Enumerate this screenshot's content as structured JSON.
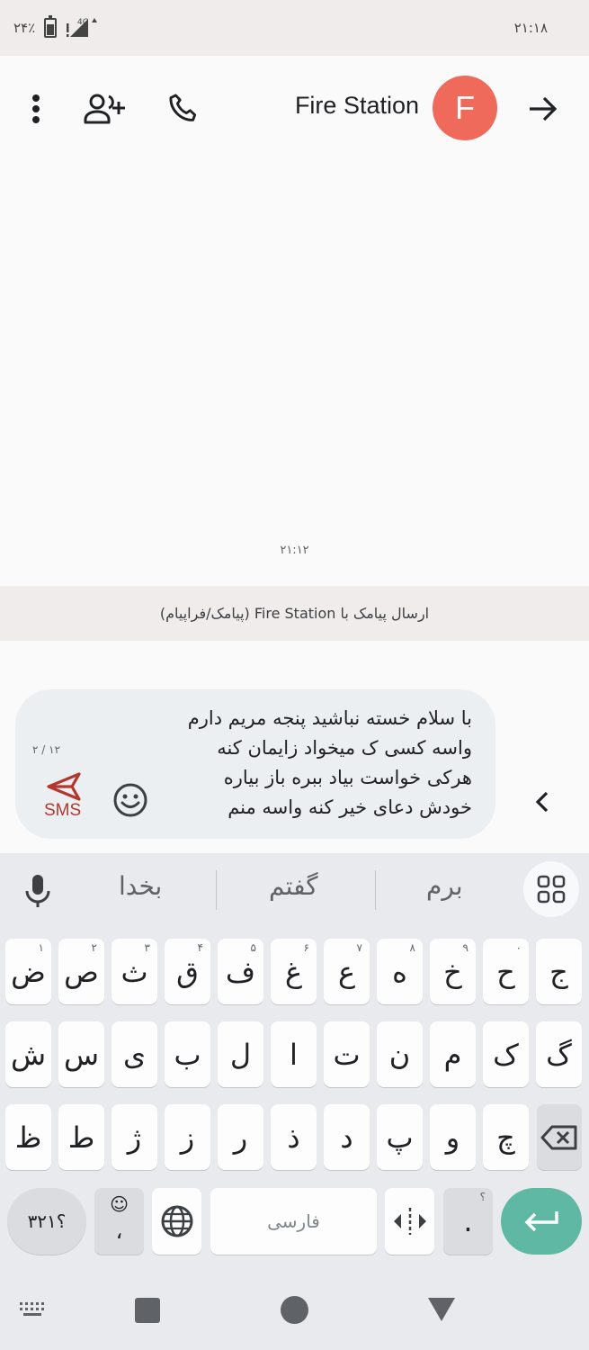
{
  "status_bar": {
    "time": "۲۱:۱۸",
    "battery_percent": "۲۴٪",
    "network": "4G"
  },
  "app_bar": {
    "contact_name": "Fire Station",
    "avatar_letter": "F",
    "icons": [
      "more-vert-icon",
      "add-person-icon",
      "phone-icon",
      "arrow-forward-icon"
    ]
  },
  "conversation": {
    "timestamp": "۲۱:۱۲",
    "send_banner": "ارسال پیامک با Fire Station (پیامک/فراپیام)"
  },
  "compose": {
    "lines": [
      "با سلام خسته نباشید پنجه مریم دارم",
      "واسه کسی ک میخواد زایمان کنه",
      "هرکی خواست بیاد ببره باز بیاره",
      "خودش دعای خیر کنه واسه منم"
    ],
    "char_count": "۲ / ۱۲",
    "send_label": "SMS",
    "accent_color": "#b3372f"
  },
  "keyboard": {
    "suggestions": [
      "برم",
      "گفتم",
      "بخدا"
    ],
    "row1": [
      {
        "k": "ج",
        "h": ""
      },
      {
        "k": "ح",
        "h": "۰"
      },
      {
        "k": "خ",
        "h": "۹"
      },
      {
        "k": "ه",
        "h": "۸"
      },
      {
        "k": "ع",
        "h": "۷"
      },
      {
        "k": "غ",
        "h": "۶"
      },
      {
        "k": "ف",
        "h": "۵"
      },
      {
        "k": "ق",
        "h": "۴"
      },
      {
        "k": "ث",
        "h": "۳"
      },
      {
        "k": "ص",
        "h": "۲"
      },
      {
        "k": "ض",
        "h": "۱"
      }
    ],
    "row2": [
      "گ",
      "ک",
      "م",
      "ن",
      "ت",
      "ا",
      "ل",
      "ب",
      "ی",
      "س",
      "ش"
    ],
    "row3": [
      "چ",
      "و",
      "پ",
      "د",
      "ذ",
      "ر",
      "ز",
      "ژ",
      "ط",
      "ظ"
    ],
    "symbols_key": "؟۳۲۱",
    "comma_key": "،",
    "space_label": "فارسی",
    "period_key": ".",
    "period_hint": "؟"
  }
}
